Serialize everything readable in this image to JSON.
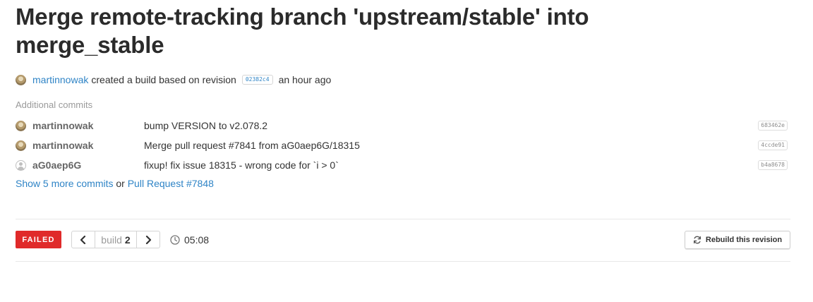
{
  "build": {
    "title": "Merge remote-tracking branch 'upstream/stable' into merge_stable",
    "creator": "martinnowak",
    "created_text": "created a build based on revision",
    "revision": "02382c4",
    "time_ago": "an hour ago"
  },
  "additional_commits": {
    "label": "Additional commits",
    "commits": [
      {
        "author": "martinnowak",
        "message": "bump VERSION to v2.078.2",
        "sha": "683462e",
        "avatar": "user-photo"
      },
      {
        "author": "martinnowak",
        "message": "Merge pull request #7841 from aG0aep6G/18315",
        "sha": "4ccde91",
        "avatar": "user-photo"
      },
      {
        "author": "aG0aep6G",
        "message": "fixup! fix issue 18315 - wrong code for `i > 0`",
        "sha": "b4a8678",
        "avatar": "default-user-icon"
      }
    ],
    "show_more": "Show 5 more commits",
    "or_text": "or",
    "pull_request": "Pull Request #7848"
  },
  "status": {
    "label": "FAILED",
    "color": "#e02a2a",
    "build_label": "build",
    "build_number": "2",
    "duration": "05:08",
    "rebuild_label": "Rebuild this revision"
  },
  "icons": {
    "prev": "chevron-left-icon",
    "next": "chevron-right-icon",
    "duration": "clock-icon",
    "rebuild": "refresh-icon"
  },
  "colors": {
    "link": "#2f84c6",
    "failed": "#e02a2a"
  }
}
